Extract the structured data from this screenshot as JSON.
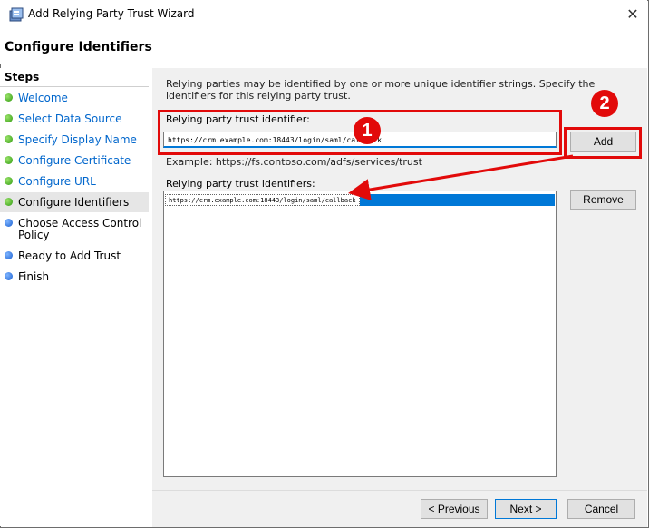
{
  "window": {
    "title": "Add Relying Party Trust Wizard",
    "close_glyph": "✕"
  },
  "page": {
    "title": "Configure Identifiers"
  },
  "steps": {
    "title": "Steps",
    "items": [
      {
        "label": "Welcome",
        "status": "done",
        "link": true
      },
      {
        "label": "Select Data Source",
        "status": "done",
        "link": true
      },
      {
        "label": "Specify Display Name",
        "status": "done",
        "link": true
      },
      {
        "label": "Configure Certificate",
        "status": "done",
        "link": true
      },
      {
        "label": "Configure URL",
        "status": "done",
        "link": true
      },
      {
        "label": "Configure Identifiers",
        "status": "current",
        "link": false
      },
      {
        "label": "Choose Access Control",
        "label2": "Policy",
        "status": "pending",
        "link": false
      },
      {
        "label": "Ready to Add Trust",
        "status": "pending",
        "link": false
      },
      {
        "label": "Finish",
        "status": "pending",
        "link": false
      }
    ]
  },
  "content": {
    "description": "Relying parties may be identified by one or more unique identifier strings. Specify the identifiers for this relying party trust.",
    "identifier_label": "Relying party trust identifier:",
    "identifier_value": "https://crm.example.com:18443/login/saml/callback",
    "example": "Example: https://fs.contoso.com/adfs/services/trust",
    "identifiers_label": "Relying party trust identifiers:",
    "identifiers": [
      "https://crm.example.com:18443/login/saml/callback"
    ]
  },
  "buttons": {
    "add": "Add",
    "remove": "Remove",
    "previous": "< Previous",
    "next": "Next >",
    "cancel": "Cancel"
  },
  "annotations": {
    "badge1": "1",
    "badge2": "2",
    "color": "#e20a0a"
  }
}
